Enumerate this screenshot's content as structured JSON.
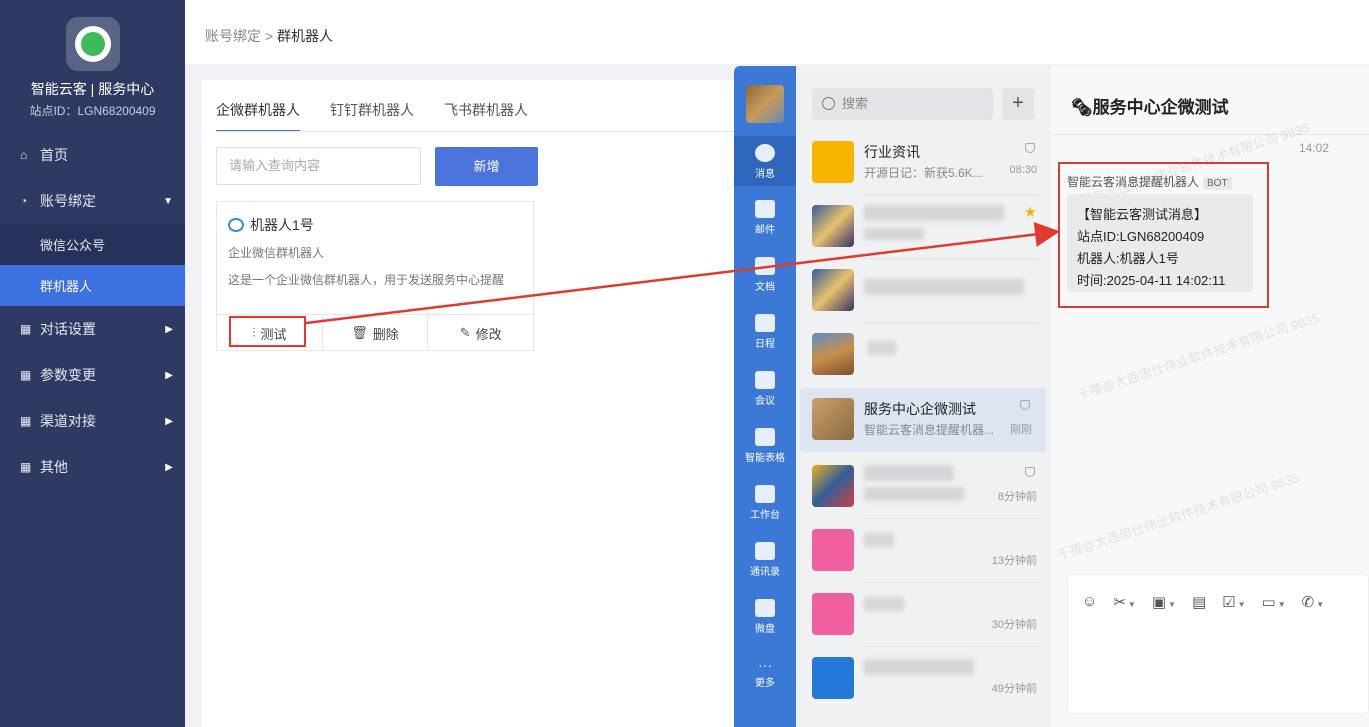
{
  "sidebar": {
    "brand": "智能云客 | 服务中心",
    "station": "站点ID：LGN68200409",
    "items": [
      {
        "label": "首页"
      },
      {
        "label": "账号绑定"
      },
      {
        "label": "微信公众号"
      },
      {
        "label": "群机器人"
      },
      {
        "label": "对话设置"
      },
      {
        "label": "参数变更"
      },
      {
        "label": "渠道对接"
      },
      {
        "label": "其他"
      }
    ]
  },
  "breadcrumb": {
    "parent": "账号绑定",
    "sep": ">",
    "current": "群机器人"
  },
  "main": {
    "tabs": [
      {
        "label": "企微群机器人"
      },
      {
        "label": "钉钉群机器人"
      },
      {
        "label": "飞书群机器人"
      }
    ],
    "search_placeholder": "请输入查询内容",
    "add_label": "新增",
    "robot": {
      "name": "机器人1号",
      "type": "企业微信群机器人",
      "desc": "这是一个企业微信群机器人，用于发送服务中心提醒",
      "actions": [
        {
          "label": "测试"
        },
        {
          "label": "删除"
        },
        {
          "label": "修改"
        }
      ]
    }
  },
  "wecom": {
    "rail": [
      {
        "label": "消息"
      },
      {
        "label": "邮件"
      },
      {
        "label": "文档"
      },
      {
        "label": "日程"
      },
      {
        "label": "会议"
      },
      {
        "label": "智能表格"
      },
      {
        "label": "工作台"
      },
      {
        "label": "通讯录"
      },
      {
        "label": "微盘"
      },
      {
        "label": "更多"
      }
    ],
    "search_placeholder": "搜索",
    "conversations": [
      {
        "name": "行业资讯",
        "preview": "开源日记：新获5.6K...",
        "time": "08:30"
      },
      {
        "name": "服务中心企微测试",
        "preview": "智能云客消息提醒机器...",
        "time": "刚刚"
      },
      {
        "time": "8分钟前"
      },
      {
        "time": "13分钟前"
      },
      {
        "time": "30分钟前"
      },
      {
        "time": "49分钟前"
      }
    ],
    "chat": {
      "title": "🗞服务中心企微测试",
      "time": "14:02",
      "sender": "智能云客消息提醒机器人",
      "bot_tag": "BOT",
      "lines": [
        "【智能云客测试消息】",
        "站点ID:LGN68200409",
        "机器人:机器人1号",
        "时间:2025-04-11 14:02:11"
      ]
    },
    "watermark": "千禧@大连忠仕伟业软件技术有限公司 9835"
  }
}
